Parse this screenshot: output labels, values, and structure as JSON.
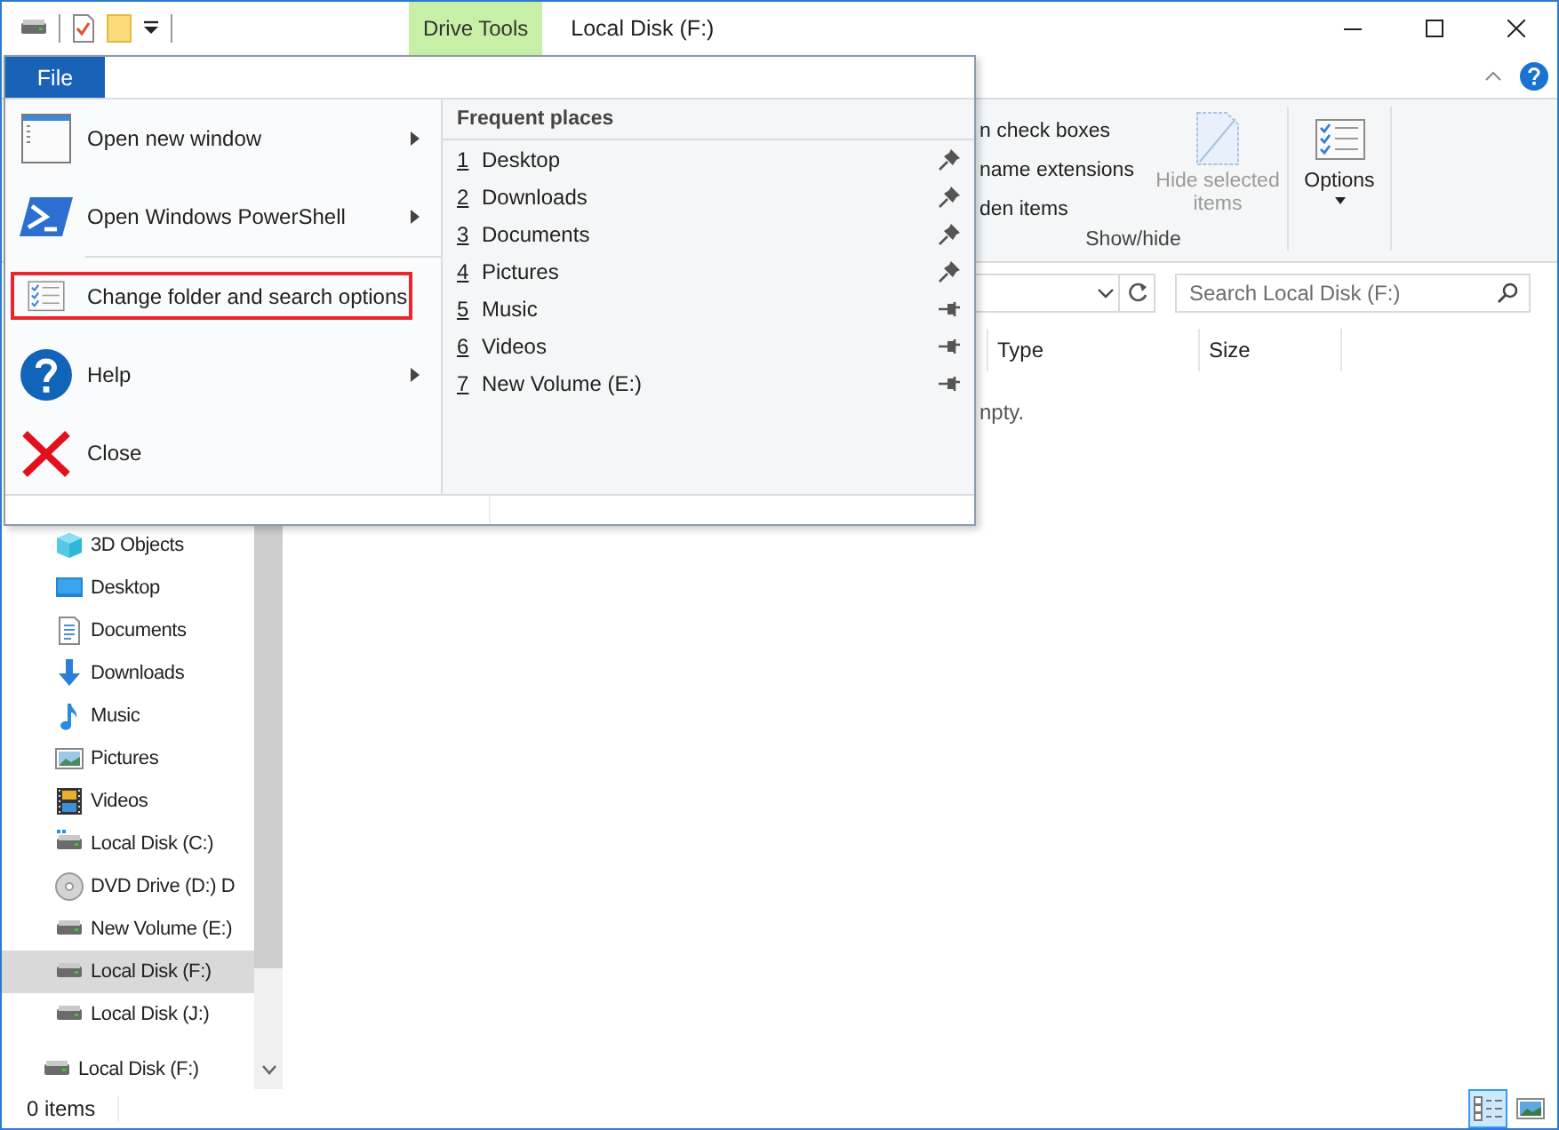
{
  "title_bar": {
    "contextual_tab": "Drive Tools",
    "title": "Local Disk (F:)"
  },
  "ribbon": {
    "show_hide": {
      "options": [
        "n check boxes",
        "name extensions",
        "den items"
      ],
      "label": "Show/hide"
    },
    "hide_selected": {
      "label": "Hide selected items",
      "disabled": true
    },
    "options": {
      "label": "Options"
    }
  },
  "address_bar": {
    "search_placeholder": "Search Local Disk (F:)"
  },
  "file_list": {
    "columns": [
      {
        "label": "Type"
      },
      {
        "label": "Size"
      }
    ],
    "empty_message": "npty."
  },
  "nav_pane": {
    "tree": [
      {
        "children": [
          {
            "kind": "cube",
            "label": "3D Objects",
            "selected": false
          },
          {
            "kind": "desktop",
            "label": "Desktop",
            "selected": false
          },
          {
            "kind": "documents",
            "label": "Documents",
            "selected": false
          },
          {
            "kind": "download",
            "label": "Downloads",
            "selected": false
          },
          {
            "kind": "music",
            "label": "Music",
            "selected": false
          },
          {
            "kind": "pictures",
            "label": "Pictures",
            "selected": false
          },
          {
            "kind": "videos",
            "label": "Videos",
            "selected": false
          },
          {
            "kind": "system-disk",
            "label": "Local Disk (C:)",
            "selected": false
          },
          {
            "kind": "dvd",
            "label": "DVD Drive (D:) D",
            "selected": false
          },
          {
            "kind": "disk",
            "label": "New Volume (E:)",
            "selected": false
          },
          {
            "kind": "disk",
            "label": "Local Disk (F:)",
            "selected": true
          },
          {
            "kind": "disk",
            "label": "Local Disk (J:)",
            "selected": false
          }
        ]
      },
      {
        "kind": "disk",
        "label": "Local Disk (F:)",
        "selected": false
      }
    ]
  },
  "status_bar": {
    "item_count": "0 items",
    "views": [
      {
        "kind": "details",
        "selected": true
      },
      {
        "kind": "large-icons",
        "selected": false
      }
    ]
  },
  "file_menu": {
    "tab": "File",
    "commands": [
      {
        "kind": "new-window",
        "label": "Open new window",
        "submenu": true,
        "highlighted": false
      },
      {
        "kind": "powershell",
        "label": "Open Windows PowerShell",
        "submenu": true,
        "highlighted": false
      },
      {
        "kind": "options",
        "label": "Change folder and search options",
        "submenu": false,
        "highlighted": true
      },
      {
        "kind": "help",
        "label": "Help",
        "submenu": true,
        "highlighted": false
      },
      {
        "kind": "close",
        "label": "Close",
        "submenu": false,
        "highlighted": false
      }
    ],
    "frequent_places": {
      "title": "Frequent places",
      "items": [
        {
          "number": "1",
          "label": "Desktop",
          "pinned": true
        },
        {
          "number": "2",
          "label": "Downloads",
          "pinned": true
        },
        {
          "number": "3",
          "label": "Documents",
          "pinned": true
        },
        {
          "number": "4",
          "label": "Pictures",
          "pinned": true
        },
        {
          "number": "5",
          "label": "Music",
          "pinned": false
        },
        {
          "number": "6",
          "label": "Videos",
          "pinned": false
        },
        {
          "number": "7",
          "label": "New Volume (E:)",
          "pinned": false
        }
      ]
    }
  }
}
